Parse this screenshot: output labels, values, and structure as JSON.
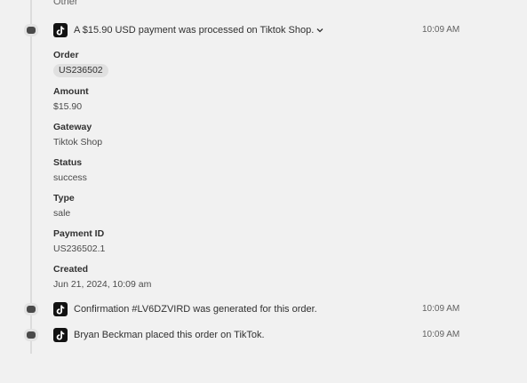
{
  "top_partial": "Other",
  "events": [
    {
      "text": "A $15.90 USD payment was processed on Tiktok Shop.",
      "time": "10:09 AM",
      "icon": "tiktok-icon",
      "expandable": true
    },
    {
      "text": "Confirmation #LV6DZVIRD was generated for this order.",
      "time": "10:09 AM",
      "icon": "tiktok-icon"
    },
    {
      "text": "Bryan Beckman placed this order on TikTok.",
      "time": "10:09 AM",
      "icon": "tiktok-icon"
    }
  ],
  "payment_details": {
    "order": {
      "label": "Order",
      "value": "US236502"
    },
    "amount": {
      "label": "Amount",
      "value": "$15.90"
    },
    "gateway": {
      "label": "Gateway",
      "value": "Tiktok Shop"
    },
    "status": {
      "label": "Status",
      "value": "success"
    },
    "type": {
      "label": "Type",
      "value": "sale"
    },
    "payment_id": {
      "label": "Payment ID",
      "value": "US236502.1"
    },
    "created": {
      "label": "Created",
      "value": "Jun 21, 2024, 10:09 am"
    }
  }
}
